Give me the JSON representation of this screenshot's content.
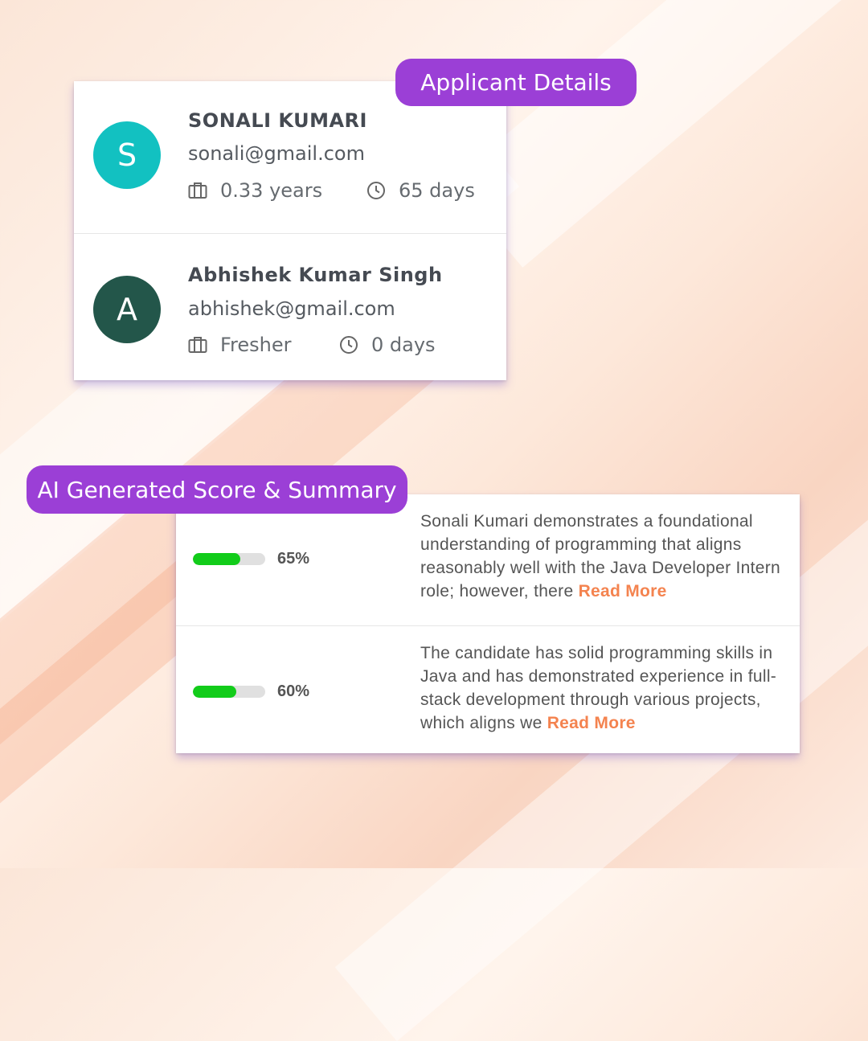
{
  "sections": {
    "applicant_details_label": "Applicant Details",
    "ai_summary_label": "AI Generated Score & Summary"
  },
  "applicants": [
    {
      "initial": "S",
      "name": "SONALI KUMARI",
      "email": "sonali@gmail.com",
      "experience": "0.33 years",
      "days": "65 days",
      "avatar_color": "#12c1c1"
    },
    {
      "initial": "A",
      "name": "Abhishek Kumar Singh",
      "email": "abhishek@gmail.com",
      "experience": "Fresher",
      "days": "0 days",
      "avatar_color": "#23564a"
    }
  ],
  "scores": [
    {
      "score": 65,
      "score_label": "65%",
      "summary": "Sonali Kumari demonstrates a foundational understanding of programming that aligns reasonably well with the Java Developer Intern role; however, there",
      "read_more": "Read More"
    },
    {
      "score": 60,
      "score_label": "60%",
      "summary": "The candidate has solid programming skills in Java and has demonstrated experience in full-stack development through various projects, which aligns we",
      "read_more": "Read More"
    }
  ],
  "colors": {
    "pill": "#9b3fd6",
    "progress": "#12cc1a",
    "read_more": "#f4834f"
  },
  "icons": {
    "experience": "briefcase-icon",
    "days": "clock-icon"
  }
}
